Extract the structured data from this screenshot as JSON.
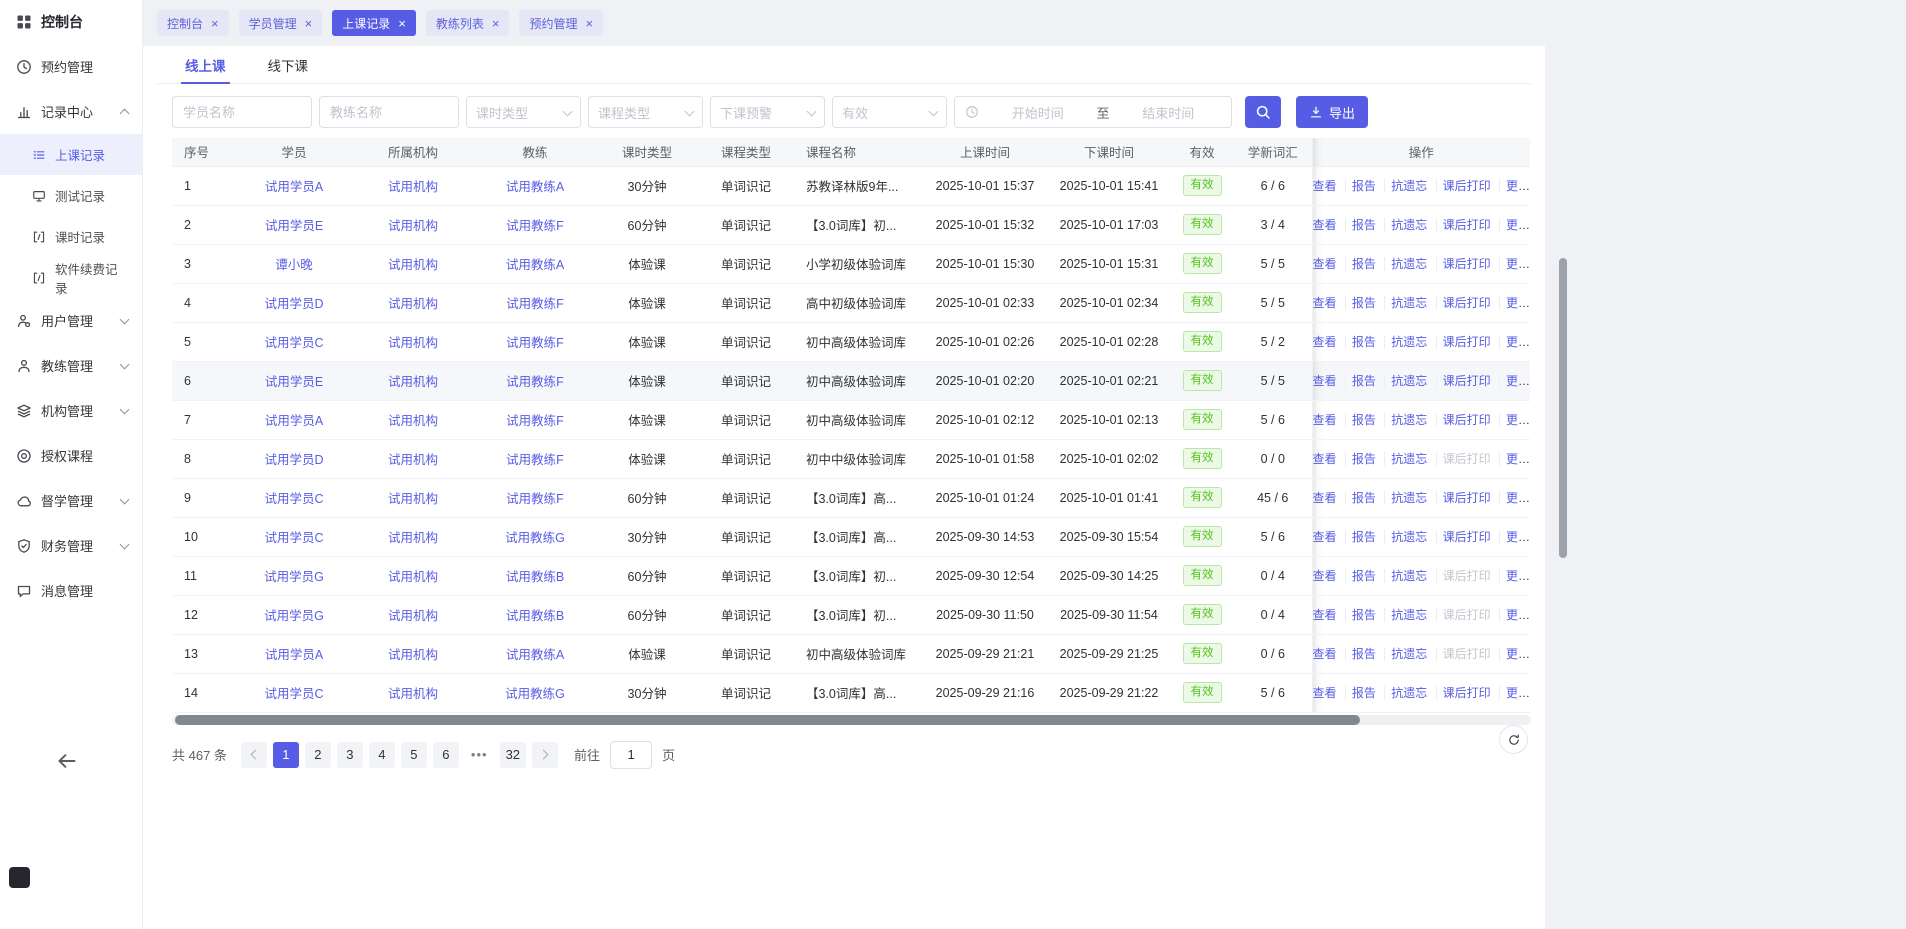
{
  "colors": {
    "primary": "#575ce5",
    "valid_green": "#52c41a"
  },
  "icons": {
    "close": "×"
  },
  "sidebar": {
    "brand": "控制台",
    "items": [
      {
        "label": "预约管理"
      },
      {
        "label": "记录中心",
        "children": [
          {
            "label": "上课记录"
          },
          {
            "label": "测试记录"
          },
          {
            "label": "课时记录"
          },
          {
            "label": "软件续费记录"
          }
        ]
      },
      {
        "label": "用户管理"
      },
      {
        "label": "教练管理"
      },
      {
        "label": "机构管理"
      },
      {
        "label": "授权课程"
      },
      {
        "label": "督学管理"
      },
      {
        "label": "财务管理"
      },
      {
        "label": "消息管理"
      }
    ]
  },
  "tabs": [
    {
      "label": "控制台"
    },
    {
      "label": "学员管理"
    },
    {
      "label": "上课记录"
    },
    {
      "label": "教练列表"
    },
    {
      "label": "预约管理"
    }
  ],
  "subtabs": [
    {
      "label": "线上课"
    },
    {
      "label": "线下课"
    }
  ],
  "filters": {
    "student_placeholder": "学员名称",
    "coach_placeholder": "教练名称",
    "selects": [
      "课时类型",
      "课程类型",
      "下课预警",
      "有效"
    ],
    "start_placeholder": "开始时间",
    "range_separator": "至",
    "end_placeholder": "结束时间",
    "export_label": "导出"
  },
  "table": {
    "headers": [
      "序号",
      "学员",
      "所属机构",
      "教练",
      "课时类型",
      "课程类型",
      "课程名称",
      "上课时间",
      "下课时间",
      "有效",
      "学新词汇",
      "操作"
    ],
    "actions": [
      "查看",
      "报告",
      "抗遗忘",
      "课后打印",
      "更多"
    ],
    "rows": [
      {
        "no": "1",
        "student": "试用学员A",
        "org": "试用机构",
        "coach": "试用教练A",
        "duration": "30分钟",
        "course_type": "单词识记",
        "course": "苏教译林版9年...",
        "start": "2025-10-01 15:37",
        "end": "2025-10-01 15:41",
        "valid": "有效",
        "words": "6 / 6",
        "print_disabled": false
      },
      {
        "no": "2",
        "student": "试用学员E",
        "org": "试用机构",
        "coach": "试用教练F",
        "duration": "60分钟",
        "course_type": "单词识记",
        "course": "【3.0词库】初...",
        "start": "2025-10-01 15:32",
        "end": "2025-10-01 17:03",
        "valid": "有效",
        "words": "3 / 4",
        "print_disabled": false
      },
      {
        "no": "3",
        "student": "谭小晚",
        "org": "试用机构",
        "coach": "试用教练A",
        "duration": "体验课",
        "course_type": "单词识记",
        "course": "小学初级体验词库",
        "start": "2025-10-01 15:30",
        "end": "2025-10-01 15:31",
        "valid": "有效",
        "words": "5 / 5",
        "print_disabled": false
      },
      {
        "no": "4",
        "student": "试用学员D",
        "org": "试用机构",
        "coach": "试用教练F",
        "duration": "体验课",
        "course_type": "单词识记",
        "course": "高中初级体验词库",
        "start": "2025-10-01 02:33",
        "end": "2025-10-01 02:34",
        "valid": "有效",
        "words": "5 / 5",
        "print_disabled": false
      },
      {
        "no": "5",
        "student": "试用学员C",
        "org": "试用机构",
        "coach": "试用教练F",
        "duration": "体验课",
        "course_type": "单词识记",
        "course": "初中高级体验词库",
        "start": "2025-10-01 02:26",
        "end": "2025-10-01 02:28",
        "valid": "有效",
        "words": "5 / 2",
        "print_disabled": false
      },
      {
        "no": "6",
        "student": "试用学员E",
        "org": "试用机构",
        "coach": "试用教练F",
        "duration": "体验课",
        "course_type": "单词识记",
        "course": "初中高级体验词库",
        "start": "2025-10-01 02:20",
        "end": "2025-10-01 02:21",
        "valid": "有效",
        "words": "5 / 5",
        "print_disabled": false
      },
      {
        "no": "7",
        "student": "试用学员A",
        "org": "试用机构",
        "coach": "试用教练F",
        "duration": "体验课",
        "course_type": "单词识记",
        "course": "初中高级体验词库",
        "start": "2025-10-01 02:12",
        "end": "2025-10-01 02:13",
        "valid": "有效",
        "words": "5 / 6",
        "print_disabled": false
      },
      {
        "no": "8",
        "student": "试用学员D",
        "org": "试用机构",
        "coach": "试用教练F",
        "duration": "体验课",
        "course_type": "单词识记",
        "course": "初中中级体验词库",
        "start": "2025-10-01 01:58",
        "end": "2025-10-01 02:02",
        "valid": "有效",
        "words": "0 / 0",
        "print_disabled": true
      },
      {
        "no": "9",
        "student": "试用学员C",
        "org": "试用机构",
        "coach": "试用教练F",
        "duration": "60分钟",
        "course_type": "单词识记",
        "course": "【3.0词库】高...",
        "start": "2025-10-01 01:24",
        "end": "2025-10-01 01:41",
        "valid": "有效",
        "words": "45 / 6",
        "print_disabled": false
      },
      {
        "no": "10",
        "student": "试用学员C",
        "org": "试用机构",
        "coach": "试用教练G",
        "duration": "30分钟",
        "course_type": "单词识记",
        "course": "【3.0词库】高...",
        "start": "2025-09-30 14:53",
        "end": "2025-09-30 15:54",
        "valid": "有效",
        "words": "5 / 6",
        "print_disabled": false
      },
      {
        "no": "11",
        "student": "试用学员G",
        "org": "试用机构",
        "coach": "试用教练B",
        "duration": "60分钟",
        "course_type": "单词识记",
        "course": "【3.0词库】初...",
        "start": "2025-09-30 12:54",
        "end": "2025-09-30 14:25",
        "valid": "有效",
        "words": "0 / 4",
        "print_disabled": true
      },
      {
        "no": "12",
        "student": "试用学员G",
        "org": "试用机构",
        "coach": "试用教练B",
        "duration": "60分钟",
        "course_type": "单词识记",
        "course": "【3.0词库】初...",
        "start": "2025-09-30 11:50",
        "end": "2025-09-30 11:54",
        "valid": "有效",
        "words": "0 / 4",
        "print_disabled": true
      },
      {
        "no": "13",
        "student": "试用学员A",
        "org": "试用机构",
        "coach": "试用教练A",
        "duration": "体验课",
        "course_type": "单词识记",
        "course": "初中高级体验词库",
        "start": "2025-09-29 21:21",
        "end": "2025-09-29 21:25",
        "valid": "有效",
        "words": "0 / 6",
        "print_disabled": true
      },
      {
        "no": "14",
        "student": "试用学员C",
        "org": "试用机构",
        "coach": "试用教练G",
        "duration": "30分钟",
        "course_type": "单词识记",
        "course": "【3.0词库】高...",
        "start": "2025-09-29 21:16",
        "end": "2025-09-29 21:22",
        "valid": "有效",
        "words": "5 / 6",
        "print_disabled": false
      }
    ]
  },
  "pagination": {
    "total": "共 467 条",
    "pages": [
      "1",
      "2",
      "3",
      "4",
      "5",
      "6"
    ],
    "ellipsis": "•••",
    "last_page": "32",
    "goto_label": "前往",
    "goto_value": "1",
    "page_unit": "页"
  }
}
